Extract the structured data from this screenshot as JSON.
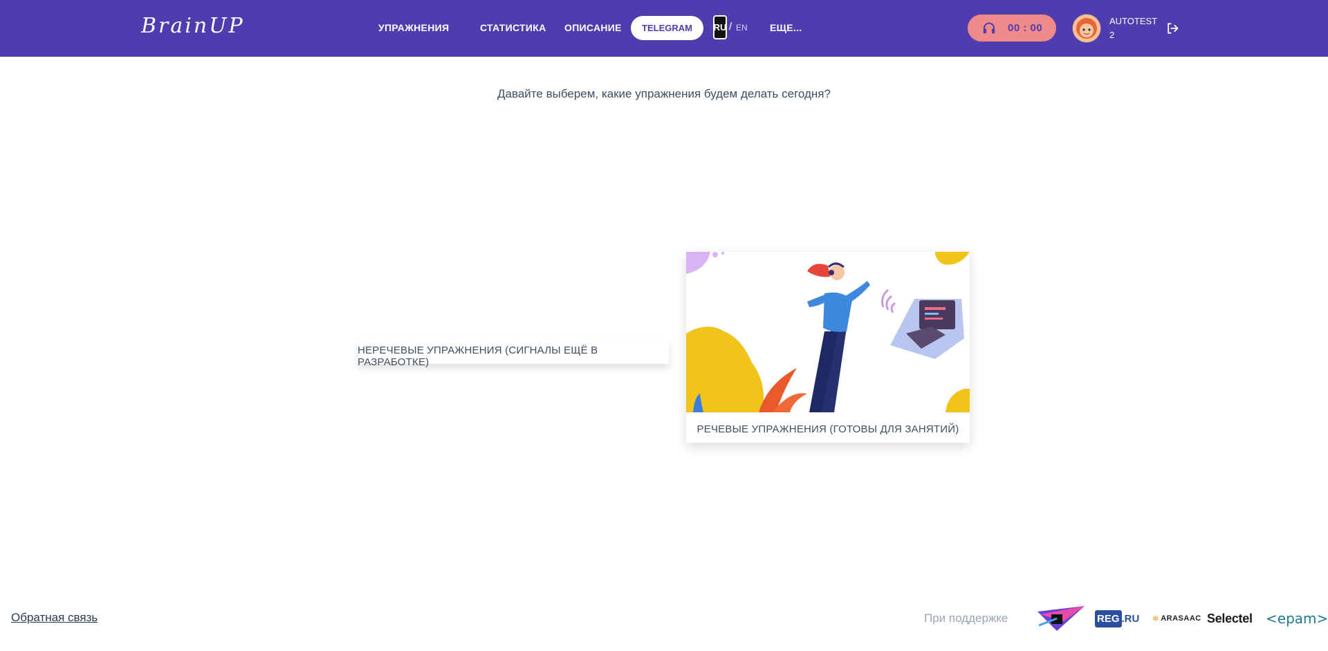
{
  "header": {
    "logo": "BrainUP",
    "nav": {
      "exercises": "УПРАЖНЕНИЯ",
      "statistics": "СТАТИСТИКА",
      "description": "ОПИСАНИЕ",
      "telegram": "TELEGRAM",
      "more": "ЕЩЕ..."
    },
    "lang": {
      "ru": "RU",
      "separator": "/",
      "en": "EN"
    },
    "timer": "00 : 00",
    "user": {
      "name": "AUTOTEST",
      "sub": "2"
    }
  },
  "main": {
    "prompt": "Давайте выберем, какие упражнения будем делать сегодня?",
    "cards": {
      "nonspeech": "НЕРЕЧЕВЫЕ УПРАЖНЕНИЯ (СИГНАЛЫ ЕЩЁ В РАЗРАБОТКЕ)",
      "speech": "РЕЧЕВЫЕ УПРАЖНЕНИЯ (ГОТОВЫ ДЛЯ ЗАНЯТИЙ)"
    }
  },
  "footer": {
    "feedback": "Обратная связь",
    "support": "При поддержке",
    "sponsors": {
      "regru_box": "REG",
      "regru_suffix": ".RU",
      "arasaac": "ARASAAC",
      "selectel": "Selectel",
      "epam": "<epam>"
    }
  },
  "colors": {
    "header_bg": "#4f3db0",
    "timer_bg": "#f08a8a",
    "accent": "#4f3db0"
  },
  "icons": [
    "headphones-icon",
    "logout-icon",
    "avatar-image",
    "speech-illustration"
  ]
}
